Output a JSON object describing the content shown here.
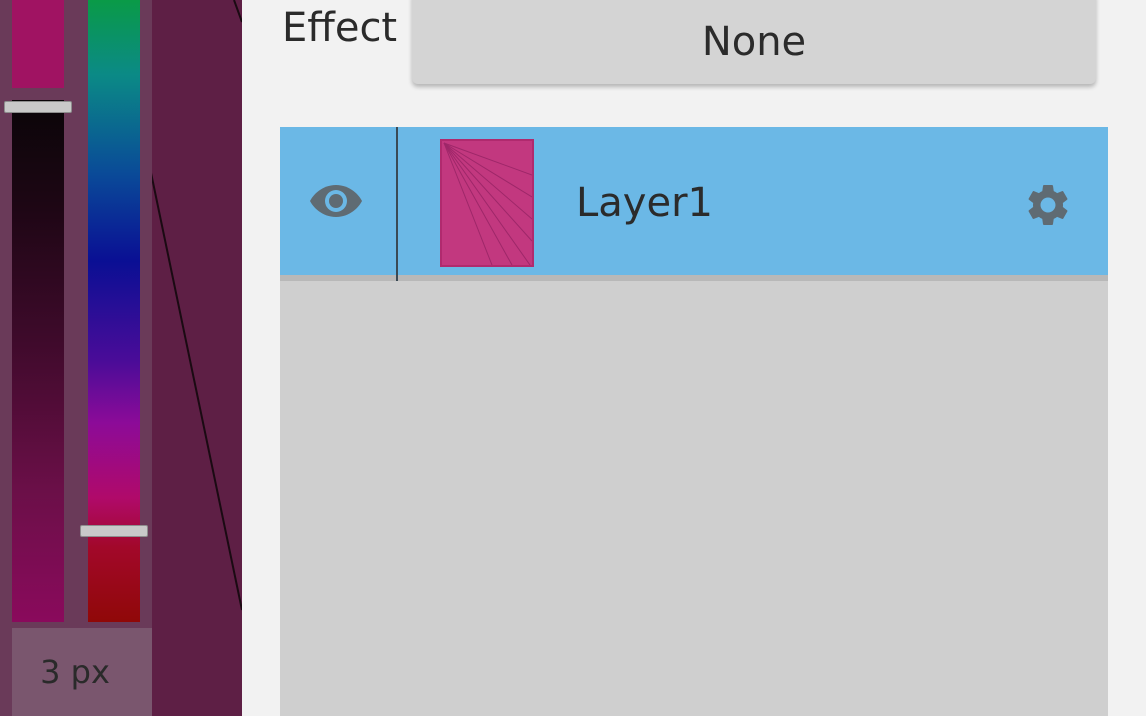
{
  "tools": {
    "brush_size_label": "3 px"
  },
  "panel": {
    "effect_label": "Effect",
    "effect_value": "None"
  },
  "layers": [
    {
      "name": "Layer1",
      "visible": true,
      "selected": true
    }
  ],
  "colors": {
    "canvas_background": "#5e1f45",
    "selected_layer": "#6bb8e6",
    "current_color": "#a01362",
    "layer_thumbnail": "#c2387f",
    "icon_color": "#5f6b73"
  },
  "icons": {
    "visibility": "eye-icon",
    "settings": "gear-icon"
  }
}
